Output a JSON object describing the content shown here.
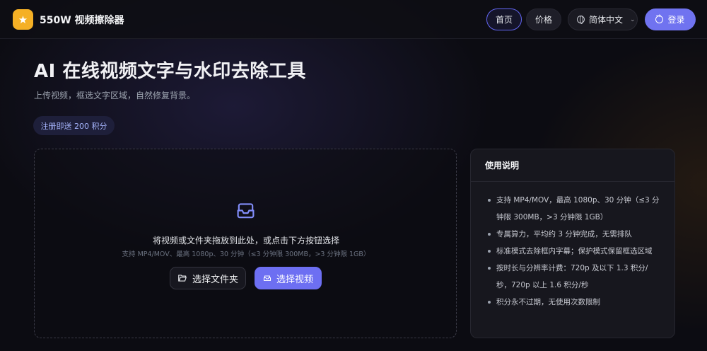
{
  "header": {
    "brand": "550W 视频擦除器",
    "nav": {
      "home": "首页",
      "price": "价格"
    },
    "language": "简体中文",
    "login": "登录"
  },
  "hero": {
    "title": "AI 在线视频文字与水印去除工具",
    "subtitle": "上传视频，框选文字区域，自然修复背景。",
    "badge": "注册即送 200 积分"
  },
  "upload": {
    "main_text": "将视频或文件夹拖放到此处，或点击下方按钮选择",
    "sub_text": "支持 MP4/MOV、最高 1080p、30 分钟（≤3 分钟限 300MB，>3 分钟限 1GB）",
    "folder_button": "选择文件夹",
    "video_button": "选择视频"
  },
  "instructions": {
    "title": "使用说明",
    "items": [
      "支持 MP4/MOV，最高 1080p、30 分钟（≤3 分钟限 300MB，>3 分钟限 1GB）",
      "专属算力，平均约 3 分钟完成，无需排队",
      "标准模式去除框内字幕；保护模式保留框选区域",
      "按时长与分辨率计费：720p 及以下 1.3 积分/秒，720p 以上 1.6 积分/秒",
      "积分永不过期，无使用次数限制"
    ]
  },
  "colors": {
    "accent": "#6d6ff2",
    "logo": "#f5b025",
    "background": "#0c0c12"
  },
  "icons": {
    "logo": "star-icon",
    "language": "globe-icon",
    "login": "login-icon",
    "upload": "inbox-tray-icon",
    "folder": "folder-open-icon",
    "video": "inbox-icon"
  }
}
